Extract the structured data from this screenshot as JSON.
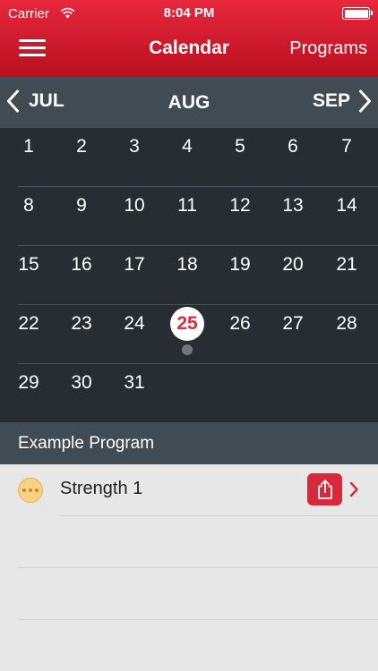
{
  "status_bar": {
    "carrier": "Carrier",
    "time": "8:04 PM",
    "wifi_icon": "wifi-icon",
    "battery_icon": "battery-icon"
  },
  "navbar": {
    "title": "Calendar",
    "programs_label": "Programs",
    "menu_icon": "hamburger-menu-icon"
  },
  "month_nav": {
    "prev": "JUL",
    "current": "AUG",
    "next": "SEP"
  },
  "calendar": {
    "weeks": [
      [
        "1",
        "2",
        "3",
        "4",
        "5",
        "6",
        "7"
      ],
      [
        "8",
        "9",
        "10",
        "11",
        "12",
        "13",
        "14"
      ],
      [
        "15",
        "16",
        "17",
        "18",
        "19",
        "20",
        "21"
      ],
      [
        "22",
        "23",
        "24",
        "25",
        "26",
        "27",
        "28"
      ],
      [
        "29",
        "30",
        "31",
        "",
        "",
        "",
        ""
      ]
    ],
    "selected_day": "25"
  },
  "program": {
    "header": "Example Program",
    "items": [
      {
        "title": "Strength 1",
        "status_icon": "in-progress-icon"
      }
    ]
  },
  "colors": {
    "accent": "#d8283a",
    "header_bar": "#414b54",
    "calendar_bg": "#272d33"
  }
}
